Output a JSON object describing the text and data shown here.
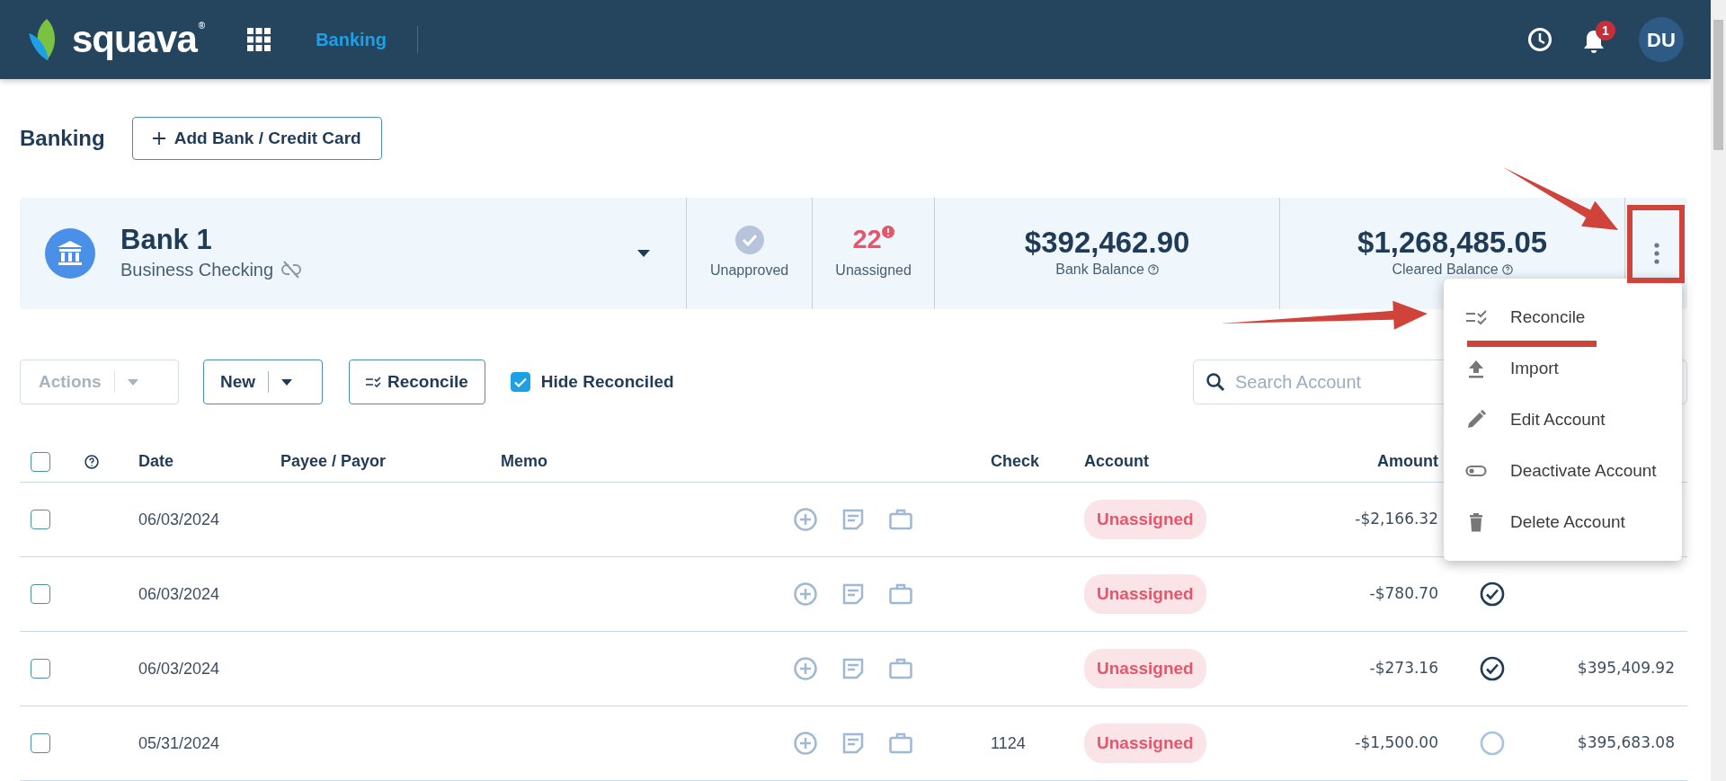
{
  "header": {
    "logo": "squava",
    "logo_mark": "®",
    "nav": [
      {
        "label": "Banking",
        "selected": true
      }
    ],
    "notification_count": "1",
    "avatar": "DU"
  },
  "page": {
    "title": "Banking",
    "add_button": "Add Bank / Credit Card"
  },
  "account": {
    "name": "Bank 1",
    "type": "Business Checking",
    "stats": [
      {
        "kind": "icon",
        "label": "Unapproved"
      },
      {
        "kind": "count",
        "value": "22",
        "label": "Unassigned"
      }
    ],
    "balances": [
      {
        "value": "$392,462.90",
        "label": "Bank Balance"
      },
      {
        "value": "$1,268,485.05",
        "label": "Cleared Balance"
      }
    ]
  },
  "toolbar": {
    "actions": {
      "label": "Actions",
      "disabled": true
    },
    "new": {
      "label": "New",
      "disabled": false
    },
    "reconcile": "Reconcile",
    "hide_reconciled": {
      "label": "Hide Reconciled",
      "checked": true
    },
    "search": {
      "placeholder": "Search Account"
    }
  },
  "table": {
    "columns": [
      "Date",
      "Payee / Payor",
      "Memo",
      "Check",
      "Account",
      "Amount"
    ],
    "select_all_checked": false,
    "rows": [
      {
        "checked": false,
        "date": "06/03/2024",
        "account": "Unassigned",
        "amount": "-$2,166.32"
      },
      {
        "checked": false,
        "date": "06/03/2024",
        "account": "Unassigned",
        "amount": "-$780.70",
        "cleared": true
      },
      {
        "checked": false,
        "date": "06/03/2024",
        "account": "Unassigned",
        "amount": "-$273.16",
        "cleared": true,
        "balance": "$395,409.92"
      },
      {
        "checked": false,
        "date": "05/31/2024",
        "check": "1124",
        "account": "Unassigned",
        "amount": "-$1,500.00",
        "cleared": false,
        "balance": "$395,683.08"
      }
    ]
  },
  "menu": {
    "items": [
      {
        "kind": "reconcile",
        "label": "Reconcile"
      },
      {
        "kind": "import",
        "label": "Import"
      },
      {
        "kind": "edit",
        "label": "Edit Account"
      },
      {
        "kind": "toggle",
        "label": "Deactivate Account"
      },
      {
        "kind": "delete",
        "label": "Delete Account"
      }
    ]
  }
}
